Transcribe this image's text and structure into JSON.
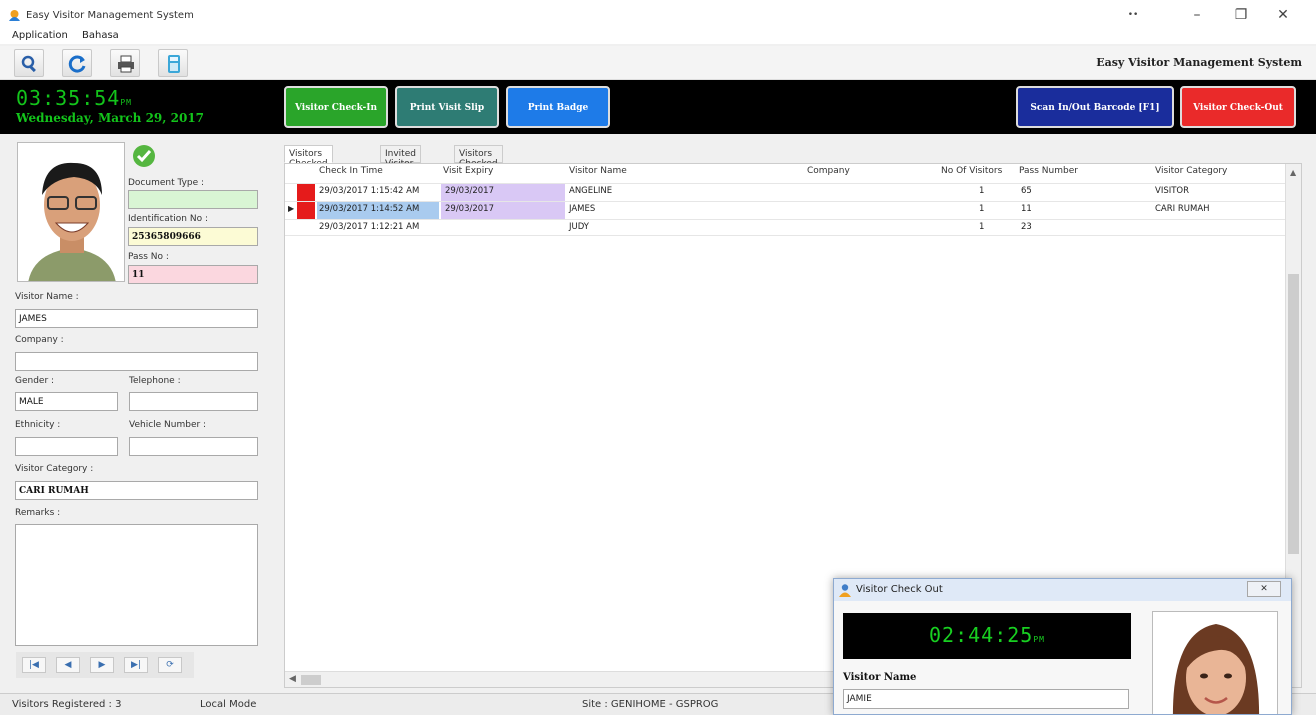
{
  "window": {
    "title": "Easy Visitor Management System",
    "minimize": "–",
    "restore": "❐",
    "close": "✕",
    "extra": "••"
  },
  "menu": [
    "Application",
    "Bahasa"
  ],
  "toolbar": {
    "brand": "Easy Visitor Management System",
    "buttons": [
      "search-icon",
      "refresh-icon",
      "print-icon",
      "calculator-icon"
    ]
  },
  "header": {
    "clock": "03:35:54",
    "clock_suffix": "PM",
    "date": "Wednesday, March 29, 2017",
    "checkin_label": "Visitor Check-In",
    "print_slip_label": "Print Visit Slip",
    "print_badge_label": "Print Badge",
    "scan_label": "Scan In/Out Barcode [F1]",
    "checkout_label": "Visitor Check-Out",
    "colors": {
      "checkin": "#2aa52a",
      "print_slip": "#2e7c74",
      "print_badge": "#1e7be8",
      "scan": "#1a2d9c",
      "checkout": "#ea2a2a"
    }
  },
  "form": {
    "document_type_label": "Document Type :",
    "document_type_value": "",
    "id_no_label": "Identification No :",
    "id_no_value": "25365809666",
    "pass_no_label": "Pass No :",
    "pass_no_value": "11",
    "visitor_name_label": "Visitor Name :",
    "visitor_name_value": "JAMES",
    "company_label": "Company :",
    "company_value": "",
    "gender_label": "Gender :",
    "gender_value": "MALE",
    "telephone_label": "Telephone :",
    "telephone_value": "",
    "ethnicity_label": "Ethnicity :",
    "ethnicity_value": "",
    "vehicle_label": "Vehicle Number :",
    "vehicle_value": "",
    "category_label": "Visitor Category :",
    "category_value": "CARI RUMAH",
    "remarks_label": "Remarks :",
    "remarks_value": ""
  },
  "nav": [
    "|◀",
    "◀",
    "▶",
    "▶|",
    "⟳"
  ],
  "tabs": [
    "Visitors Checked In",
    "Invited Visitor",
    "Visitors Checked Out"
  ],
  "grid": {
    "columns": [
      "Check In Time",
      "Visit Expiry",
      "Visitor Name",
      "Company",
      "No Of Visitors",
      "Pass Number",
      "Visitor Category"
    ],
    "rows": [
      {
        "check_in": "29/03/2017 1:15:42 AM",
        "expiry": "29/03/2017",
        "name": "ANGELINE",
        "company": "",
        "visitors": "1",
        "pass": "65",
        "category": "VISITOR"
      },
      {
        "check_in": "29/03/2017 1:14:52 AM",
        "expiry": "29/03/2017",
        "name": "JAMES",
        "company": "",
        "visitors": "1",
        "pass": "11",
        "category": "CARI RUMAH"
      },
      {
        "check_in": "29/03/2017 1:12:21 AM",
        "expiry": "",
        "name": "JUDY",
        "company": "",
        "visitors": "1",
        "pass": "23",
        "category": ""
      }
    ]
  },
  "status": {
    "registered": "Visitors Registered : 3",
    "mode": "Local Mode",
    "site": "Site : GENIHOME - GSPROG"
  },
  "popup": {
    "title": "Visitor Check Out",
    "close": "✕",
    "clock": "02:44:25",
    "clock_suffix": "PM",
    "name_label": "Visitor Name",
    "name_value": "JAMIE"
  }
}
